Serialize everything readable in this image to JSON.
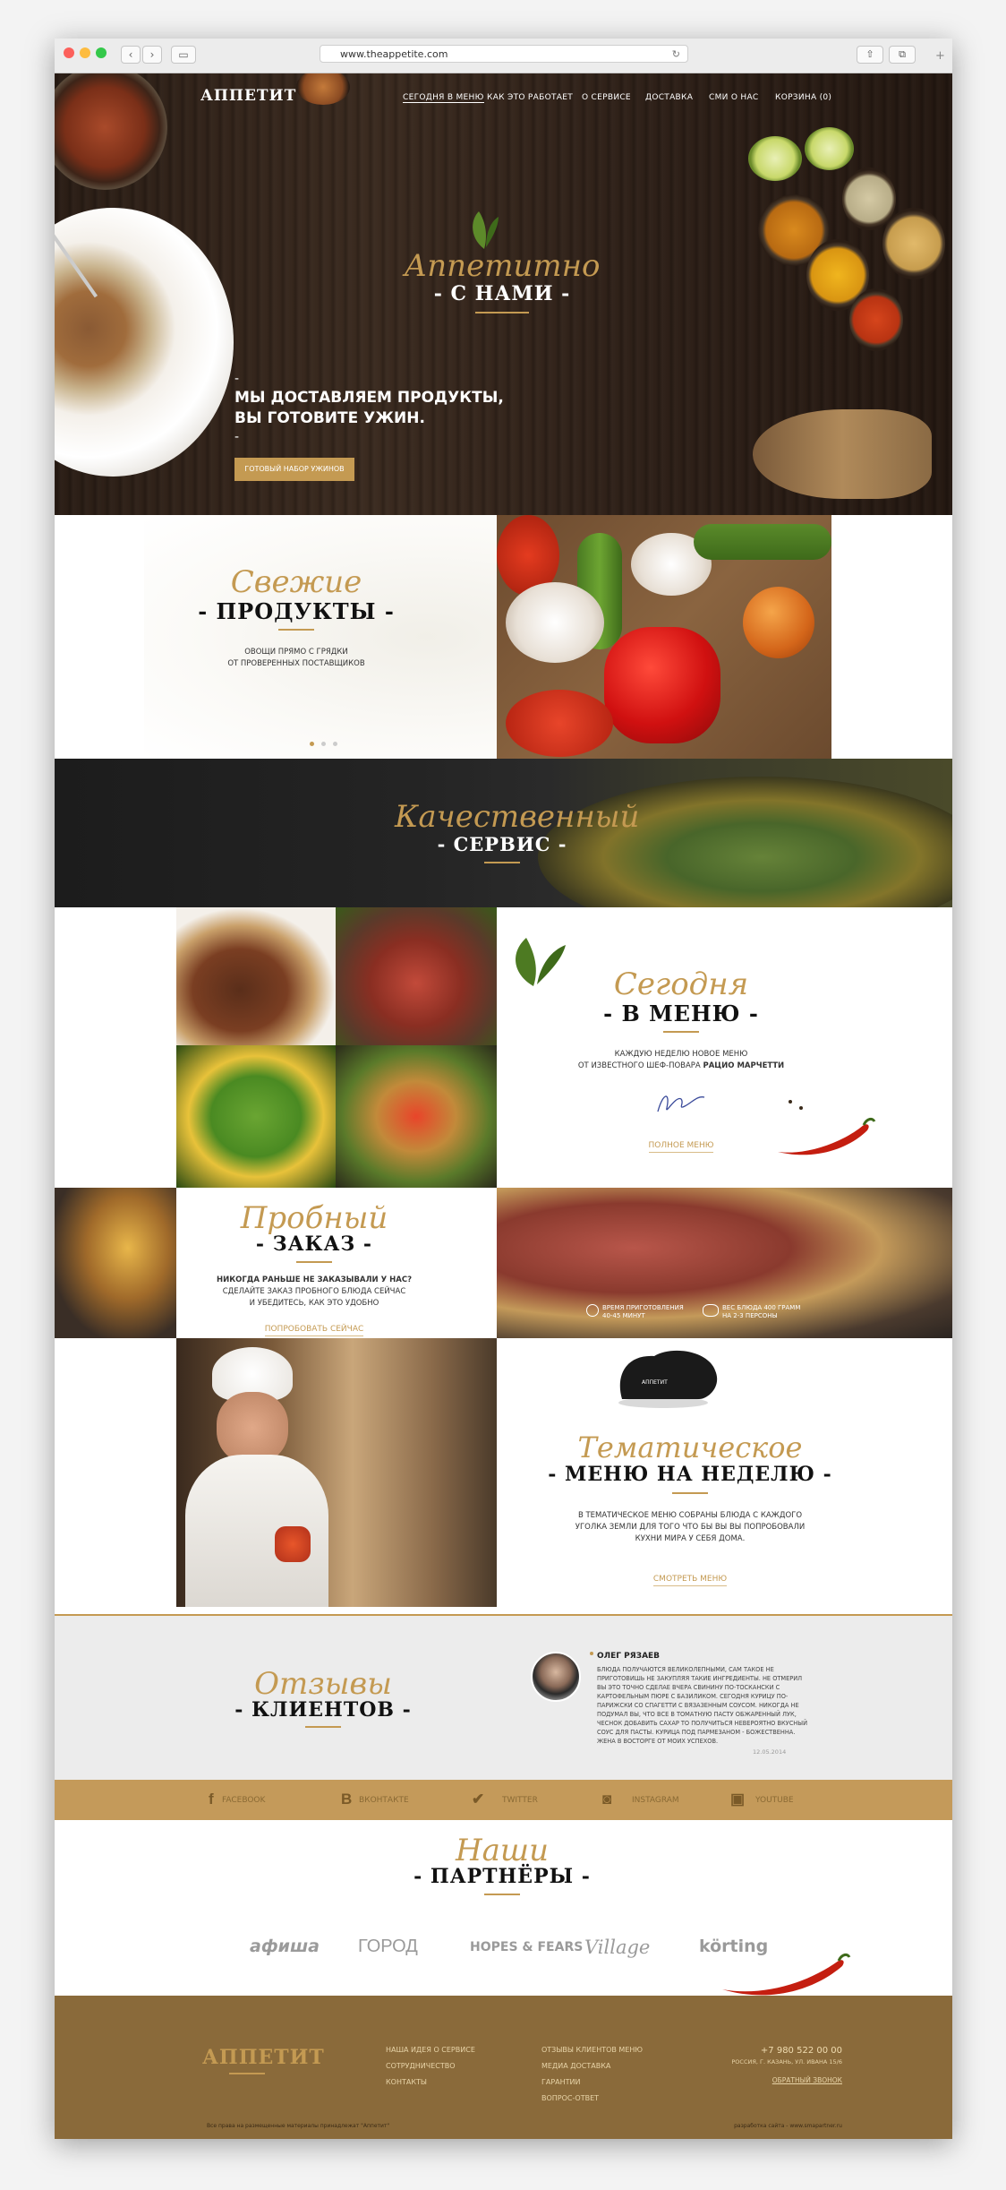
{
  "browser": {
    "url": "www.theappetite.com"
  },
  "header": {
    "logo": "АППЕТИТ",
    "nav": [
      "СЕГОДНЯ В МЕНЮ",
      "КАК ЭТО РАБОТАЕТ",
      "О СЕРВИСЕ",
      "ДОСТАВКА",
      "СМИ О НАС",
      "КОРЗИНА (0)"
    ]
  },
  "hero": {
    "script": "Аппетитно",
    "title": "- С НАМИ -",
    "dash1": "-",
    "line1": "МЫ ДОСТАВЛЯЕМ ПРОДУКТЫ,",
    "line2": "ВЫ ГОТОВИТЕ УЖИН.",
    "dash2": "-",
    "button": "ГОТОВЫЙ НАБОР УЖИНОВ"
  },
  "fresh": {
    "script": "Свежие",
    "title": "- ПРОДУКТЫ -",
    "line1": "ОВОЩИ ПРЯМО С ГРЯДКИ",
    "line2": "ОТ ПРОВЕРЕННЫХ ПОСТАВЩИКОВ"
  },
  "service": {
    "script": "Качественный",
    "title": "- СЕРВИС -"
  },
  "menu": {
    "script": "Сегодня",
    "title": "- В МЕНЮ -",
    "line1": "КАЖДУЮ НЕДЕЛЮ НОВОЕ МЕНЮ",
    "line2_pre": "ОТ ИЗВЕСТНОГО ШЕФ-ПОВАРА",
    "line2_bold": "РАЦИО МАРЧЕТТИ",
    "link": "ПОЛНОЕ МЕНЮ"
  },
  "trial": {
    "script": "Пробный",
    "title": "- ЗАКАЗ -",
    "question": "НИКОГДА РАНЬШЕ НЕ ЗАКАЗЫВАЛИ У НАС?",
    "line1": "СДЕЛАЙТЕ ЗАКАЗ ПРОБНОГО БЛЮДА СЕЙЧАС",
    "line2": "И УБЕДИТЕСЬ, КАК ЭТО УДОБНО",
    "link": "ПОПРОБОВАТЬ СЕЙЧАС",
    "time1": "ВРЕМЯ ПРИГОТОВЛЕНИЯ",
    "time2": "40-45 МИНУТ",
    "weight1": "ВЕС БЛЮДА 400 ГРАММ",
    "weight2": "НА 2-3 ПЕРСОНЫ"
  },
  "thematic": {
    "script": "Тематическое",
    "title": "- МЕНЮ НА НЕДЕЛЮ -",
    "line1": "В ТЕМАТИЧЕСКОЕ МЕНЮ СОБРАНЫ БЛЮДА С КАЖДОГО",
    "line2": "УГОЛКА ЗЕМЛИ ДЛЯ ТОГО ЧТО БЫ ВЫ ВЫ ПОПРОБОВАЛИ",
    "line3": "КУХНИ МИРА У СЕБЯ ДОМА.",
    "link": "СМОТРЕТЬ МЕНЮ",
    "hat_label": "АППЕТИТ"
  },
  "reviews": {
    "script": "Отзывы",
    "title": "- КЛИЕНТОВ -",
    "name": "ОЛЕГ РЯЗАЕВ",
    "text": "БЛЮДА ПОЛУЧАЮТСЯ ВЕЛИКОЛЕПНЫМИ, САМ ТАКОЕ НЕ ПРИГОТОВИШЬ НЕ ЗАКУПЛЯЯ ТАКИЕ ИНГРЕДИЕНТЫ. НЕ ОТМЕРИЛ ВЫ ЭТО ТОЧНО СДЕЛАЕ ВЧЕРА СВИНИНУ ПО-ТОСКАНСКИ С КАРТОФЕЛЬНЫМ ПЮРЕ С БАЗИЛИКОМ. СЕГОДНЯ КУРИЦУ ПО-ПАРИЖСКИ СО СПАГЕТТИ С ВЯЗАЗЕННЫМ СОУСОМ. НИКОГДА НЕ ПОДУМАЛ ВЫ, ЧТО ВСЕ В ТОМАТНУЮ ПАСТУ ОБЖАРЕННЫЙ ЛУК, ЧЕСНОК ДОБАВИТЬ САХАР ТО ПОЛУЧИТЬСЯ НЕВЕРОЯТНО ВКУСНЫЙ СОУС ДЛЯ ПАСТЫ. КУРИЦА ПОД ПАРМЕЗАНОМ - БОЖЕСТВЕННА. ЖЕНА В ВОСТОРГЕ ОТ МОИХ УСПЕХОВ.",
    "date": "12.05.2014"
  },
  "social": [
    "FACEBOOK",
    "ВКОНТАКТЕ",
    "TWITTER",
    "INSTAGRAM",
    "YOUTUBE"
  ],
  "partners": {
    "script": "Наши",
    "title": "- ПАРТНЁРЫ -",
    "logos": [
      "афиша",
      "ГОРОД",
      "HOPES & FEARS",
      "Village",
      "körting"
    ]
  },
  "footer": {
    "logo": "АППЕТИТ",
    "col1": [
      "НАША ИДЕЯ О СЕРВИСЕ",
      "СОТРУДНИЧЕСТВО",
      "КОНТАКТЫ"
    ],
    "col2": [
      "ОТЗЫВЫ КЛИЕНТОВ МЕНЮ",
      "МЕДИА ДОСТАВКА",
      "ГАРАНТИИ",
      "ВОПРОС-ОТВЕТ"
    ],
    "phone": "+7 980 522 00 00",
    "address": "РОССИЯ, Г. КАЗАНЬ, УЛ. ИВАНА 15/6",
    "callback": "ОБРАТНЫЙ ЗВОНОК",
    "copyright": "Все права на размещенные материалы принадлежат \"Аппетит\"",
    "dev": "разработка сайта - www.smapartner.ru"
  }
}
